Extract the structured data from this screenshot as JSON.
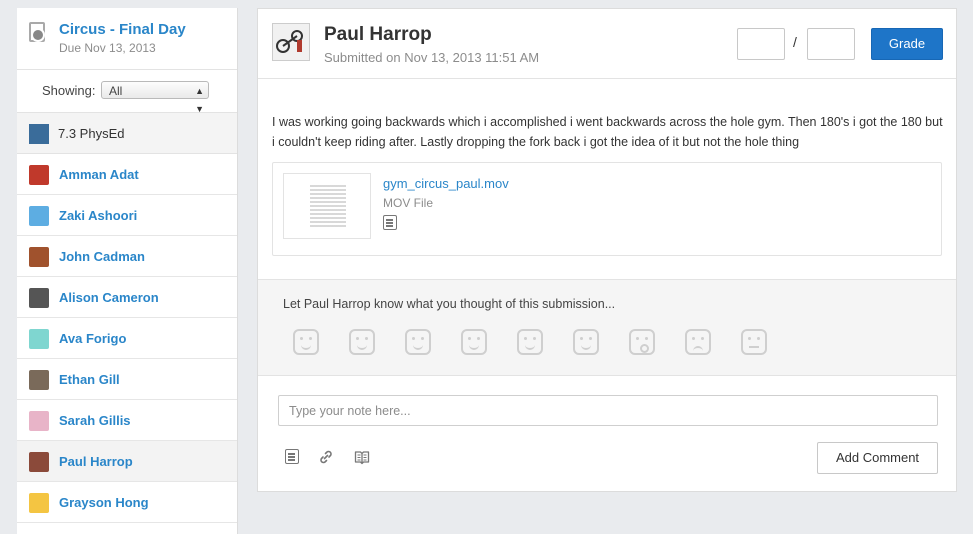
{
  "assignment": {
    "title": "Circus - Final Day",
    "due": "Due Nov 13, 2013"
  },
  "filter": {
    "label": "Showing:",
    "selected": "All"
  },
  "group": {
    "name": "7.3 PhysEd",
    "color": "#3a6c9a"
  },
  "students": [
    {
      "name": "Amman Adat",
      "avatar_color": "#c0392b"
    },
    {
      "name": "Zaki Ashoori",
      "avatar_color": "#5dade2"
    },
    {
      "name": "John Cadman",
      "avatar_color": "#a0522d"
    },
    {
      "name": "Alison Cameron",
      "avatar_color": "#555555"
    },
    {
      "name": "Ava Forigo",
      "avatar_color": "#7fd6d0"
    },
    {
      "name": "Ethan Gill",
      "avatar_color": "#7a6a5a"
    },
    {
      "name": "Sarah Gillis",
      "avatar_color": "#e8b4c8"
    },
    {
      "name": "Paul Harrop",
      "avatar_color": "#8b4a3a",
      "selected": true
    },
    {
      "name": "Grayson Hong",
      "avatar_color": "#f4c542"
    }
  ],
  "submission": {
    "student": "Paul Harrop",
    "submitted": "Submitted on Nov 13, 2013 11:51 AM",
    "grade_slash": "/",
    "grade_button": "Grade",
    "body": "I was working going backwards which i accomplished i went backwards across the hole gym. Then 180's i got the 180 but i couldn't keep riding after. Lastly dropping the fork back i got the idea of it but not the hole thing",
    "attachment": {
      "filename": "gym_circus_paul.mov",
      "type": "MOV File"
    }
  },
  "feedback": {
    "prompt": "Let Paul Harrop know what you thought of this submission...",
    "reactions": [
      "smile",
      "happy",
      "smile",
      "smile",
      "smile",
      "smile",
      "surprised",
      "sad",
      "flat"
    ]
  },
  "comment": {
    "placeholder": "Type your note here...",
    "add_button": "Add Comment"
  },
  "accent_color": "#1e75c8",
  "link_color": "#2a86c9"
}
